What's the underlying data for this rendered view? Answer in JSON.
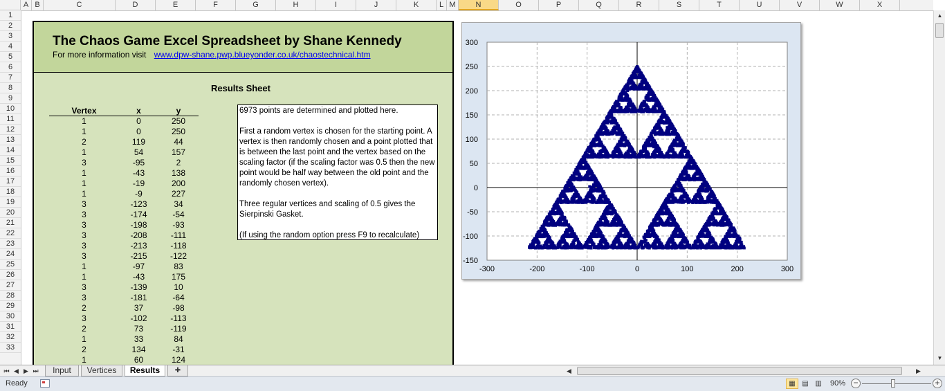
{
  "spreadsheet": {
    "columns": [
      "A",
      "B",
      "C",
      "D",
      "E",
      "F",
      "G",
      "H",
      "I",
      "J",
      "K",
      "L",
      "M",
      "N",
      "O",
      "P",
      "Q",
      "R",
      "S",
      "T",
      "U",
      "V",
      "W",
      "X"
    ],
    "selected_column": "N",
    "rows": [
      "1",
      "2",
      "3",
      "4",
      "5",
      "6",
      "7",
      "8",
      "9",
      "10",
      "11",
      "12",
      "13",
      "14",
      "15",
      "16",
      "17",
      "18",
      "19",
      "20",
      "21",
      "22",
      "23",
      "24",
      "25",
      "26",
      "27",
      "28",
      "29",
      "30",
      "31",
      "32",
      "33"
    ]
  },
  "banner": {
    "title": "The Chaos Game Excel Spreadsheet by Shane Kennedy",
    "info_label": "For more information visit",
    "info_link": "www.dpw-shane.pwp.blueyonder.co.uk/chaostechnical.htm"
  },
  "results_title": "Results Sheet",
  "table": {
    "headers": [
      "Vertex",
      "x",
      "y"
    ],
    "rows": [
      [
        "1",
        "0",
        "250"
      ],
      [
        "1",
        "0",
        "250"
      ],
      [
        "2",
        "119",
        "44"
      ],
      [
        "1",
        "54",
        "157"
      ],
      [
        "3",
        "-95",
        "2"
      ],
      [
        "1",
        "-43",
        "138"
      ],
      [
        "1",
        "-19",
        "200"
      ],
      [
        "1",
        "-9",
        "227"
      ],
      [
        "3",
        "-123",
        "34"
      ],
      [
        "3",
        "-174",
        "-54"
      ],
      [
        "3",
        "-198",
        "-93"
      ],
      [
        "3",
        "-208",
        "-111"
      ],
      [
        "3",
        "-213",
        "-118"
      ],
      [
        "3",
        "-215",
        "-122"
      ],
      [
        "1",
        "-97",
        "83"
      ],
      [
        "1",
        "-43",
        "175"
      ],
      [
        "3",
        "-139",
        "10"
      ],
      [
        "3",
        "-181",
        "-64"
      ],
      [
        "2",
        "37",
        "-98"
      ],
      [
        "3",
        "-102",
        "-113"
      ],
      [
        "2",
        "73",
        "-119"
      ],
      [
        "1",
        "33",
        "84"
      ],
      [
        "2",
        "134",
        "-31"
      ],
      [
        "1",
        "60",
        "124"
      ]
    ]
  },
  "description": {
    "paragraphs": [
      "6973 points are determined and plotted here.",
      "First a random vertex is chosen for the starting point. A vertex is then randomly chosen and a point plotted that is between the last point and the vertex based on the scaling factor (if the scaling factor was 0.5 then the new point would be half way between the old point and the randomly chosen vertex).",
      "Three regular vertices and scaling of 0.5 gives the Sierpinski Gasket.",
      "(If using the random option press F9 to recalculate)"
    ]
  },
  "chart_data": {
    "type": "scatter",
    "xlim": [
      -300,
      300
    ],
    "ylim": [
      -150,
      300
    ],
    "xticks": [
      "-300",
      "-200",
      "-100",
      "0",
      "100",
      "200",
      "300"
    ],
    "yticks": [
      "300",
      "250",
      "200",
      "150",
      "100",
      "50",
      "0",
      "-50",
      "-100",
      "-150"
    ],
    "grid": true,
    "series": [
      {
        "color": "#000080",
        "vertices": [
          [
            0,
            250
          ],
          [
            -216.5,
            -125
          ],
          [
            216.5,
            -125
          ]
        ],
        "scale": 0.5,
        "point_count": 6973,
        "visible_points": [
          [
            0,
            250
          ],
          [
            0,
            250
          ],
          [
            119,
            44
          ],
          [
            54,
            157
          ],
          [
            -95,
            2
          ],
          [
            -43,
            138
          ],
          [
            -19,
            200
          ],
          [
            -9,
            227
          ],
          [
            -123,
            34
          ],
          [
            -174,
            -54
          ],
          [
            -198,
            -93
          ],
          [
            -208,
            -111
          ],
          [
            -213,
            -118
          ],
          [
            -215,
            -122
          ],
          [
            -97,
            83
          ],
          [
            -43,
            175
          ],
          [
            -139,
            10
          ],
          [
            -181,
            -64
          ],
          [
            37,
            -98
          ],
          [
            -102,
            -113
          ],
          [
            73,
            -119
          ],
          [
            33,
            84
          ],
          [
            134,
            -31
          ],
          [
            60,
            124
          ]
        ]
      }
    ]
  },
  "sheet_tabs": [
    "Input",
    "Vertices",
    "Results"
  ],
  "active_tab": "Results",
  "status": {
    "ready": "Ready",
    "zoom": "90%"
  },
  "icons": {
    "nav_first": "first-sheet-icon",
    "nav_prev": "prev-sheet-icon",
    "nav_next": "next-sheet-icon",
    "nav_last": "last-sheet-icon",
    "new_sheet": "insert-sheet-icon",
    "macro": "macro-record-icon",
    "normal_view": "normal-view-icon",
    "page_layout": "page-layout-icon",
    "page_break": "page-break-preview-icon"
  }
}
